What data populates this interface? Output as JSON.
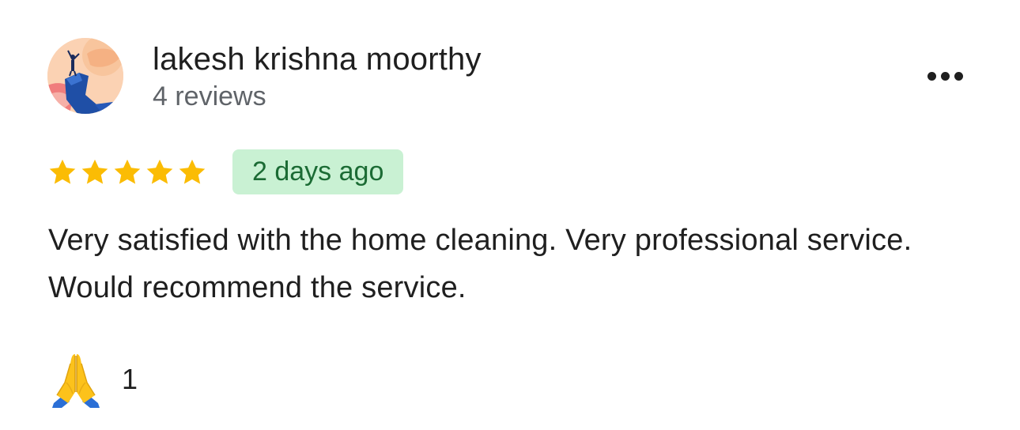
{
  "review": {
    "author_name": "lakesh krishna moorthy",
    "author_meta": "4 reviews",
    "rating": 5,
    "max_rating": 5,
    "date_badge": "2 days ago",
    "text": "Very satisfied with the home cleaning. Very professional service. Would recommend the service.",
    "reaction_icon": "folded-hands-icon",
    "reaction_count": "1"
  },
  "icons": {
    "more": "more-horizontal-icon",
    "star": "star-icon"
  },
  "colors": {
    "star": "#fbbc04",
    "badge_bg": "#c9f1d3",
    "badge_text": "#1b6b34",
    "secondary_text": "#5f6368",
    "primary_text": "#1f1f1f"
  }
}
